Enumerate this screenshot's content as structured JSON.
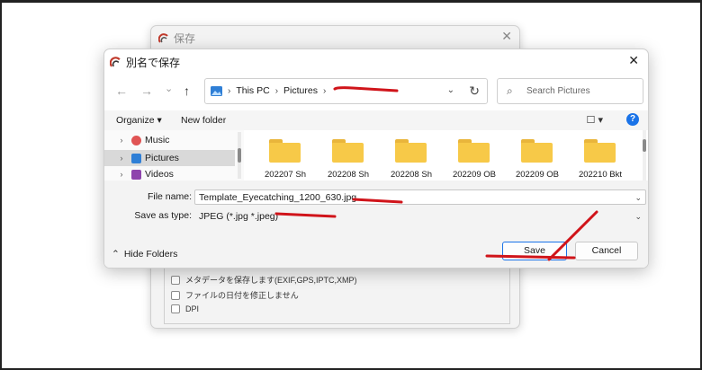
{
  "background_dialog": {
    "title": "保存",
    "close": "✕",
    "options": [
      {
        "label": "メタデータを保存します(EXIF,GPS,IPTC,XMP)"
      },
      {
        "label": "ファイルの日付を修正しません"
      },
      {
        "label": "DPI"
      }
    ]
  },
  "dialog": {
    "title": "別名で保存",
    "close": "✕",
    "nav": {
      "back": "←",
      "forward": "→",
      "recent": "⌄",
      "up": "↑"
    },
    "address": {
      "segments": [
        "This PC",
        "Pictures"
      ],
      "separator": "›",
      "dropdown": "⌄",
      "refresh": "↻"
    },
    "search": {
      "placeholder": "Search Pictures",
      "icon": "⌕"
    },
    "toolbar": {
      "organize": "Organize ▾",
      "new_folder": "New folder",
      "view": "☐ ▾",
      "help": "?"
    },
    "nav_pane": {
      "items": [
        {
          "label": "Music",
          "icon": "music-icon",
          "color": "#e05454",
          "selected": false
        },
        {
          "label": "Pictures",
          "icon": "pictures-icon",
          "color": "#2f7fd6",
          "selected": true
        },
        {
          "label": "Videos",
          "icon": "videos-icon",
          "color": "#8e44ad",
          "selected": false
        }
      ],
      "chevron": "›"
    },
    "folders": [
      {
        "name": "202207 Sh"
      },
      {
        "name": "202208 Sh"
      },
      {
        "name": "202208 Sh"
      },
      {
        "name": "202209 OB"
      },
      {
        "name": "202209 OB"
      },
      {
        "name": "202210 Bkt"
      }
    ],
    "file_name": {
      "label": "File name:",
      "value": "Template_Eyecatching_1200_630.jpg"
    },
    "save_as_type": {
      "label": "Save as type:",
      "value": "JPEG (*.jpg *.jpeg)"
    },
    "hide_folders": "Hide Folders",
    "hide_folders_icon": "⌃",
    "save_label": "Save",
    "cancel_label": "Cancel"
  },
  "colors": {
    "accent": "#1a73e8",
    "annotation": "#d0141a",
    "folder": "#f7c948"
  }
}
